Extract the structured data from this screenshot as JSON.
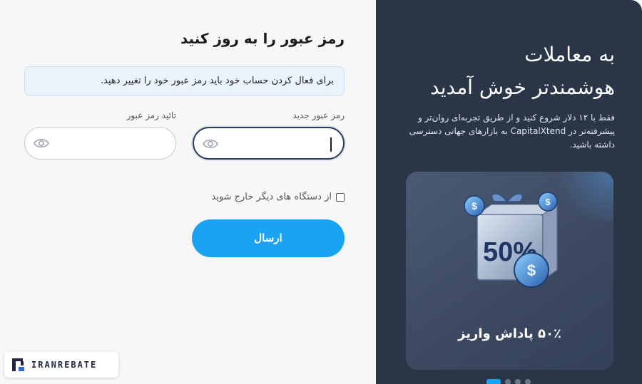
{
  "form": {
    "title": "رمز عبور را به روز کنید",
    "info_message": "برای فعال کردن حساب خود باید رمز عبور خود را تغییر دهید.",
    "new_password_label": "رمز عبور جدید",
    "confirm_password_label": "تائید رمز عبور",
    "new_password_value": "",
    "confirm_password_value": "",
    "logout_other_devices_label": "از دستگاه های دیگر خارج شوید",
    "logout_other_devices_checked": false,
    "submit_label": "ارسال"
  },
  "watermark": {
    "text": "IRANREBATE"
  },
  "promo": {
    "heading_line1": "به معاملات",
    "heading_line2": "هوشمندتر خوش آمدید",
    "description": "فقط با ۱۲ دلار شروع کنید و از طریق تجربه‌ای روان‌تر و پیشرفته‌تر در CapitalXtend به بازارهای جهانی دسترسی داشته باشید.",
    "card_art_text": "50%",
    "card_caption": "۵۰٪ پاداش واریز",
    "carousel_dots": 4,
    "active_dot": 0
  },
  "colors": {
    "accent": "#1aa3f3",
    "dark_panel": "#2a3648",
    "info_bg": "#eaf2fc"
  }
}
